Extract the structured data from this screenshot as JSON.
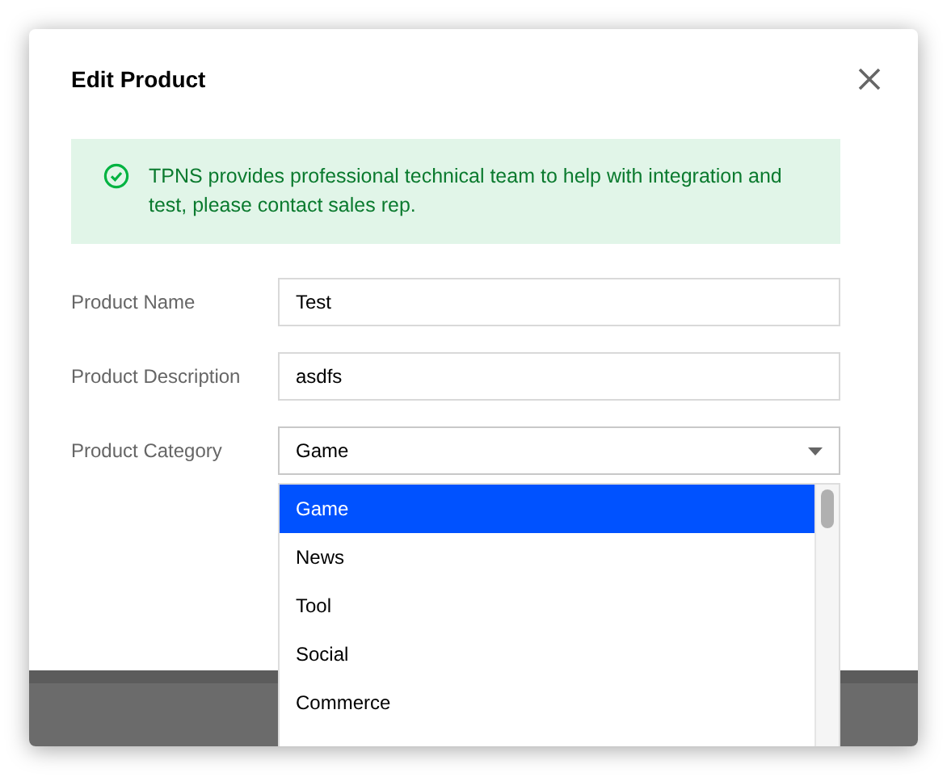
{
  "dialog": {
    "title": "Edit Product"
  },
  "alert": {
    "text": "TPNS provides professional technical team to help with integration and test, please contact sales rep."
  },
  "fields": [
    {
      "label": "Product Name",
      "kind": "text",
      "value": "Test"
    },
    {
      "label": "Product Description",
      "kind": "text",
      "value": "asdfs"
    },
    {
      "label": "Product Category",
      "kind": "select",
      "value": "Game",
      "expanded": true
    }
  ],
  "options": [
    {
      "label": "Game",
      "selected": true
    },
    {
      "label": "News",
      "selected": false
    },
    {
      "label": "Tool",
      "selected": false
    },
    {
      "label": "Social",
      "selected": false
    },
    {
      "label": "Commerce",
      "selected": false
    }
  ]
}
